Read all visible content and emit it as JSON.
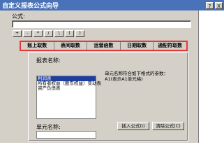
{
  "window": {
    "title": "自定义报表公式向导",
    "help_btn": "?",
    "close_btn": "X"
  },
  "formula": {
    "label": "公式:",
    "value": ""
  },
  "operators": [
    "+",
    "-",
    "*",
    "/",
    "\\",
    "(",
    ")"
  ],
  "tabs": [
    "账上取数",
    "表间取数",
    "运营函数",
    "日期取数",
    "通配符取数"
  ],
  "report": {
    "label": "报表名称:",
    "items": [
      {
        "text": "利润表",
        "selected": true
      },
      {
        "text": "所有者权益（股东权益）变动表",
        "selected": false
      },
      {
        "text": "资产负债表",
        "selected": false
      }
    ]
  },
  "description": {
    "line1": "单元名称符合如下格式的参数：",
    "line2": "A1(表示A1单元格)"
  },
  "cell": {
    "label": "单元名称:",
    "value": ""
  },
  "buttons": {
    "insert": "插入公式(I)",
    "clear": "清除公式(C)"
  }
}
